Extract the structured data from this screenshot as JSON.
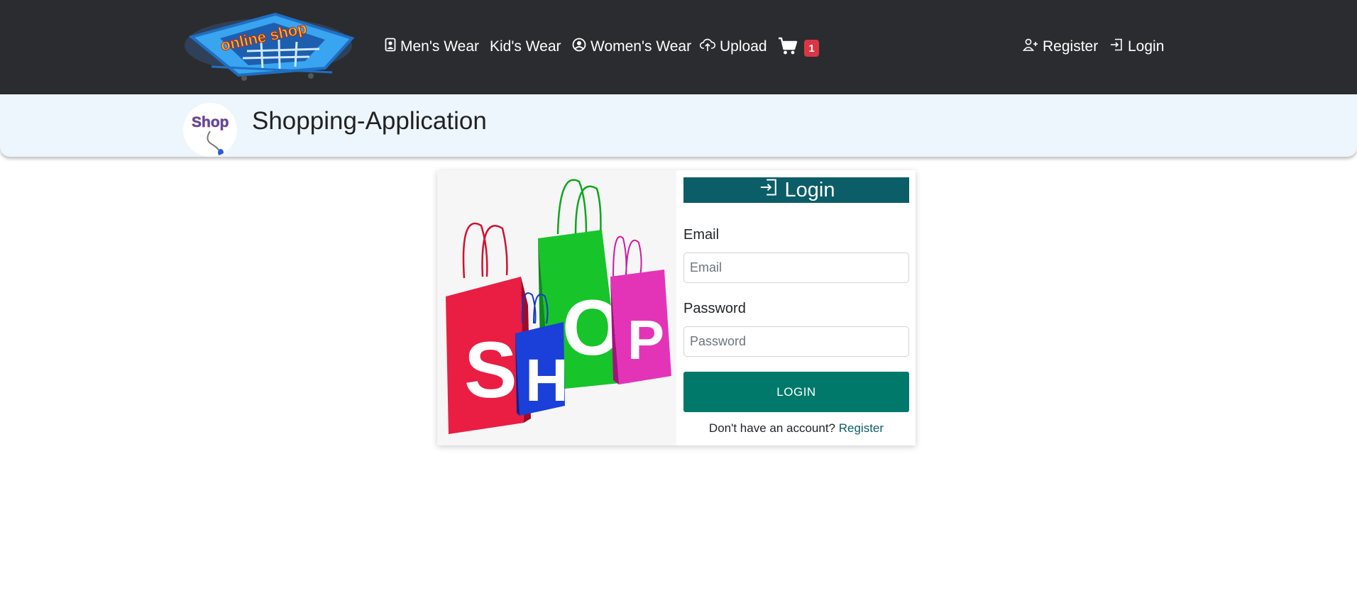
{
  "navbar": {
    "logo_text": "online shop",
    "items": [
      {
        "label": "Men's Wear",
        "icon": "person-badge-icon"
      },
      {
        "label": "Kid's Wear",
        "icon": ""
      },
      {
        "label": "Women's Wear",
        "icon": "person-circle-icon"
      },
      {
        "label": "Upload",
        "icon": "cloud-upload-icon"
      }
    ],
    "cart_icon": "cart-icon",
    "cart_count": "1",
    "register_label": "Register",
    "login_label": "Login"
  },
  "subheader": {
    "app_icon_text": "Shop",
    "title": "Shopping-Application"
  },
  "login_card": {
    "image_letters": [
      "S",
      "H",
      "O",
      "P"
    ],
    "header": "Login",
    "email_label": "Email",
    "email_placeholder": "Email",
    "email_value": "",
    "password_label": "Password",
    "password_placeholder": "Password",
    "password_value": "",
    "button_label": "LOGIN",
    "no_account_text": "Don't have an account?",
    "register_link": "Register"
  },
  "colors": {
    "navbar_bg": "#2b2c2f",
    "subheader_bg": "#edf5fd",
    "login_header_bg": "#0b5d68",
    "login_button_bg": "#00796b",
    "badge_bg": "#dc3545"
  }
}
